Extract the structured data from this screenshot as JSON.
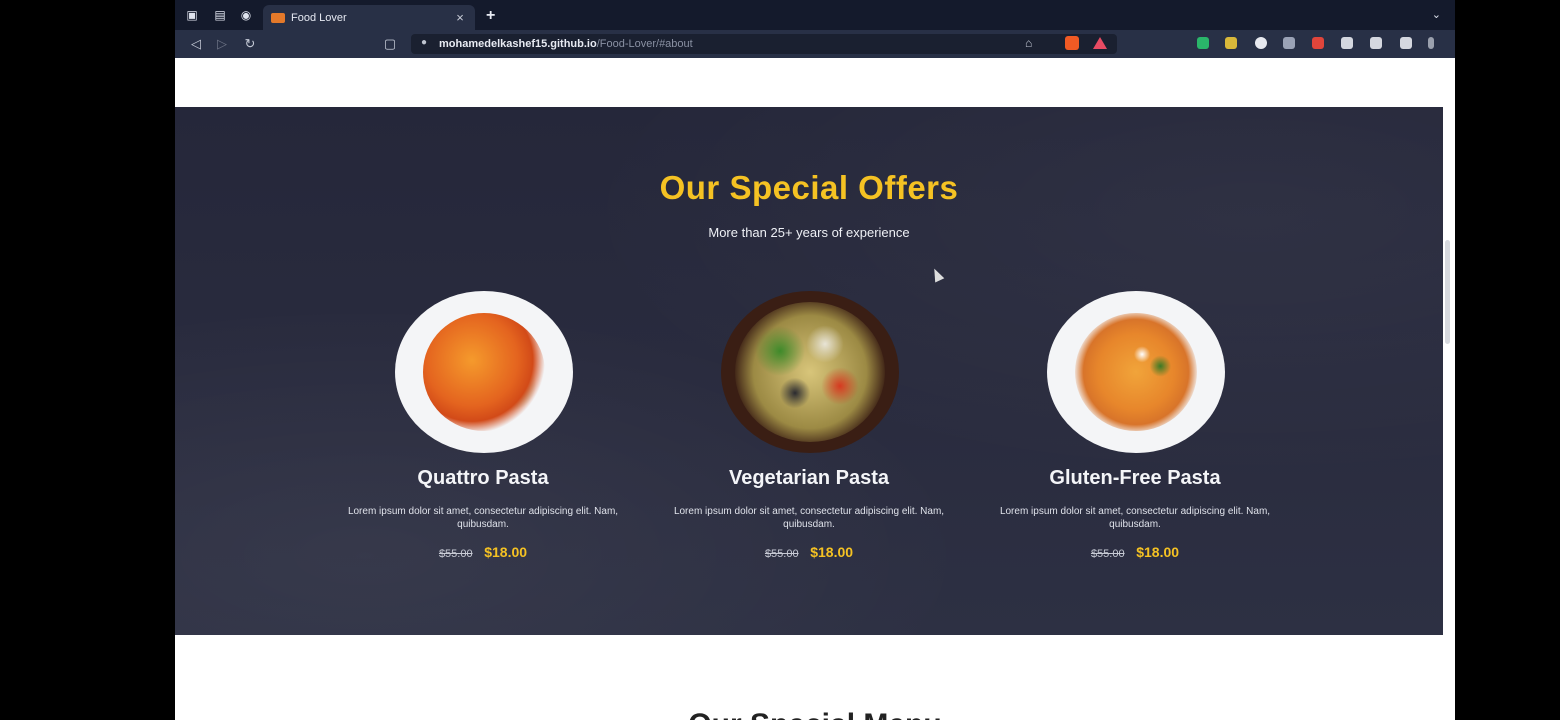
{
  "browser": {
    "tab_title": "Food Lover",
    "close_glyph": "×",
    "new_tab_glyph": "+",
    "url_domain": "mohamedelkashef15.github.io",
    "url_path": "/Food-Lover/#about",
    "icons": [
      "back-icon",
      "forward-icon",
      "reload-icon",
      "bookmark-icon",
      "lock-icon",
      "share-icon",
      "brave-shield-icon",
      "rewards-icon"
    ]
  },
  "offers": {
    "title": "Our Special Offers",
    "subtitle": "More than 25+ years of experience",
    "items": [
      {
        "name": "Quattro Pasta",
        "desc": "Lorem ipsum dolor sit amet, consectetur adipiscing elit. Nam, quibusdam.",
        "old_price": "$55.00",
        "new_price": "$18.00"
      },
      {
        "name": "Vegetarian Pasta",
        "desc": "Lorem ipsum dolor sit amet, consectetur adipiscing elit. Nam, quibusdam.",
        "old_price": "$55.00",
        "new_price": "$18.00"
      },
      {
        "name": "Gluten-Free Pasta",
        "desc": "Lorem ipsum dolor sit amet, consectetur adipiscing elit. Nam, quibusdam.",
        "old_price": "$55.00",
        "new_price": "$18.00"
      }
    ]
  },
  "menu": {
    "heading": "Our Special Menu"
  },
  "colors": {
    "accent": "#f5c223",
    "section_bg": "#26283b",
    "chrome": "#283046"
  }
}
